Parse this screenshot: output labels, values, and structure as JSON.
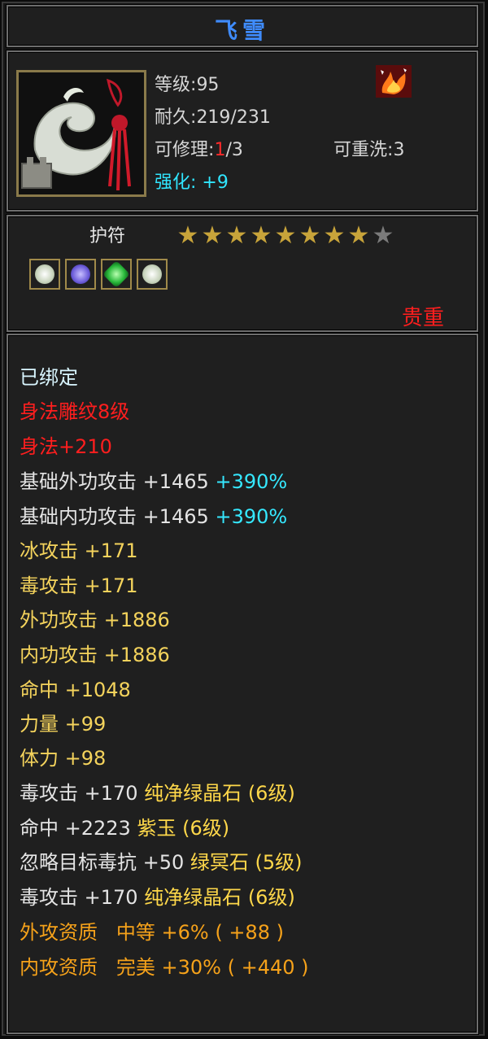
{
  "item": {
    "name": "飞雪",
    "level_label": "等级",
    "level": "95",
    "durability_label": "耐久",
    "durability": "219/231",
    "repair_label": "可修理",
    "repair_used": "1",
    "repair_total": "/3",
    "rewash_label": "可重洗",
    "rewash": "3",
    "enhance_label": "强化:",
    "enhance": "+9",
    "category": "护符",
    "stars_lit": 8,
    "stars_total": 9,
    "rarity": "贵重"
  },
  "gems": [
    {
      "icon": "white-jade-gem-icon",
      "color": "#dfe8d6"
    },
    {
      "icon": "purple-jade-gem-icon",
      "color": "#6a5ad8"
    },
    {
      "icon": "green-crystal-gem-icon",
      "color": "#28b83a"
    },
    {
      "icon": "white-jade-gem-icon",
      "color": "#dfe8d6"
    }
  ],
  "attributes": {
    "bound": "已绑定",
    "engrave": "身法雕纹8级",
    "agility": "身法+210",
    "base_ext_attack": "基础外功攻击 +1465",
    "base_ext_attack_pct": "+390%",
    "base_int_attack": "基础内功攻击 +1465",
    "base_int_attack_pct": "+390%",
    "ice_attack": "冰攻击 +171",
    "poison_attack": "毒攻击 +171",
    "ext_attack": "外功攻击 +1886",
    "int_attack": "内功攻击 +1886",
    "hit": "命中 +1048",
    "strength": "力量 +99",
    "stamina": "体力 +98",
    "gem1_stat": "毒攻击 +170",
    "gem1_name": "纯净绿晶石 (6级)",
    "gem2_stat": "命中 +2223",
    "gem2_name": "紫玉 (6级)",
    "gem3_stat": "忽略目标毒抗 +50",
    "gem3_name": "绿冥石 (5级)",
    "gem4_stat": "毒攻击 +170",
    "gem4_name": "纯净绿晶石 (6级)",
    "ext_quality_label": "外攻资质",
    "ext_quality": "中等 +6% ( +88 )",
    "int_quality_label": "内攻资质",
    "int_quality": "完美 +30% ( +440 )"
  },
  "colors": {
    "title": "#3f8cff",
    "red": "#ff1e1e",
    "yellow": "#f4d35c",
    "cyan": "#35e8ff",
    "orange": "#f6a21a"
  }
}
